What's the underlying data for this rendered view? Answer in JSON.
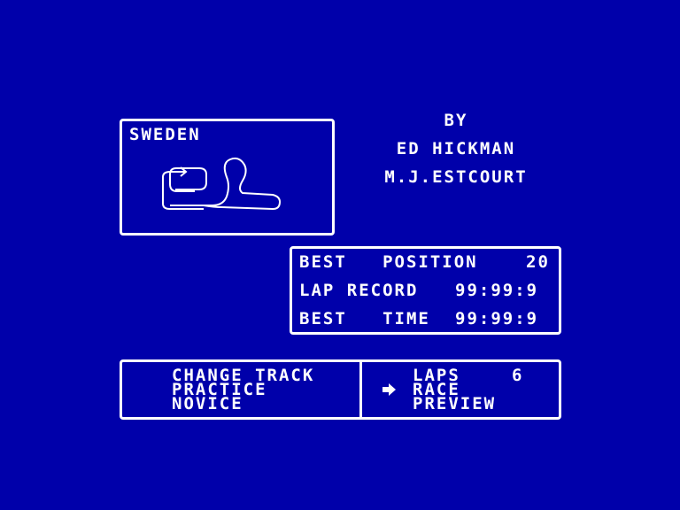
{
  "track": {
    "name": "SWEDEN"
  },
  "credits": {
    "by": "BY",
    "author1": "ED HICKMAN",
    "author2": "M.J.ESTCOURT"
  },
  "stats": {
    "best_position_label": "BEST   POSITION",
    "best_position_value": "20",
    "lap_record_label": "LAP RECORD",
    "lap_record_value": "99:99:9",
    "best_time_label": "BEST   TIME",
    "best_time_value": "99:99:9"
  },
  "menu": {
    "left_items": [
      "CHANGE TRACK",
      "PRACTICE",
      "NOVICE"
    ],
    "right_items": [
      "LAPS",
      "RACE",
      "PREVIEW"
    ],
    "laps_value": "6",
    "selected_item": "RACE"
  },
  "colors": {
    "background": "#0000aa",
    "foreground": "#ffffff"
  }
}
